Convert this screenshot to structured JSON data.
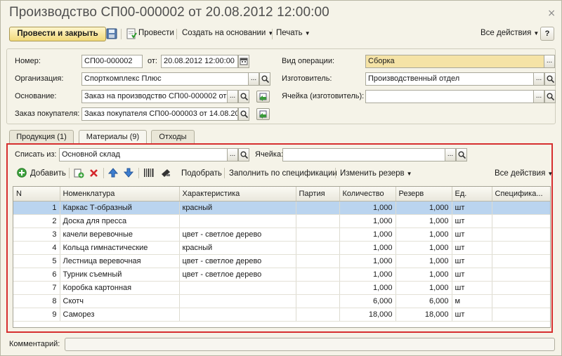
{
  "window": {
    "title": "Производство СП00-000002 от 20.08.2012 12:00:00",
    "close_glyph": "×"
  },
  "toolbar": {
    "post_close": "Провести и закрыть",
    "post": "Провести",
    "create_based": "Создать на основании",
    "print": "Печать",
    "all_actions": "Все действия",
    "help": "?"
  },
  "header": {
    "number_label": "Номер:",
    "number_value": "СП00-000002",
    "date_label": "от:",
    "date_value": "20.08.2012 12:00:00",
    "org_label": "Организация:",
    "org_value": "Спорткомплекс Плюс",
    "base_label": "Основание:",
    "base_value": "Заказ на производство СП00-000002 от",
    "order_label": "Заказ покупателя:",
    "order_value": "Заказ покупателя СП00-000003 от 14.08.20",
    "op_type_label": "Вид операции:",
    "op_type_value": "Сборка",
    "maker_label": "Изготовитель:",
    "maker_value": "Производственный отдел",
    "cell_label": "Ячейка (изготовитель):",
    "cell_value": ""
  },
  "tabs": [
    {
      "label": "Продукция (1)"
    },
    {
      "label": "Материалы (9)"
    },
    {
      "label": "Отходы"
    }
  ],
  "materials": {
    "writeoff_label": "Списать из:",
    "writeoff_value": "Основной склад",
    "cell_label": "Ячейка:",
    "cell_value": "",
    "add": "Добавить",
    "pick": "Подобрать",
    "fill_spec": "Заполнить по спецификации",
    "change_reserve": "Изменить резерв",
    "all_actions": "Все действия"
  },
  "grid": {
    "columns": [
      "N",
      "Номенклатура",
      "Характеристика",
      "Партия",
      "Количество",
      "Резерв",
      "Ед.",
      "Специфика..."
    ],
    "rows": [
      {
        "n": "1",
        "name": "Каркас Т-образный",
        "char": "красный",
        "batch": "",
        "qty": "1,000",
        "reserve": "1,000",
        "unit": "шт",
        "spec": ""
      },
      {
        "n": "2",
        "name": "Доска для пресса",
        "char": "",
        "batch": "",
        "qty": "1,000",
        "reserve": "1,000",
        "unit": "шт",
        "spec": ""
      },
      {
        "n": "3",
        "name": "качели веревочные",
        "char": "цвет - светлое дерево",
        "batch": "",
        "qty": "1,000",
        "reserve": "1,000",
        "unit": "шт",
        "spec": ""
      },
      {
        "n": "4",
        "name": "Кольца гимнастические",
        "char": "красный",
        "batch": "",
        "qty": "1,000",
        "reserve": "1,000",
        "unit": "шт",
        "spec": ""
      },
      {
        "n": "5",
        "name": "Лестница веревочная",
        "char": "цвет - светлое дерево",
        "batch": "",
        "qty": "1,000",
        "reserve": "1,000",
        "unit": "шт",
        "spec": ""
      },
      {
        "n": "6",
        "name": "Турник съемный",
        "char": "цвет - светлое дерево",
        "batch": "",
        "qty": "1,000",
        "reserve": "1,000",
        "unit": "шт",
        "spec": ""
      },
      {
        "n": "7",
        "name": "Коробка картонная",
        "char": "",
        "batch": "",
        "qty": "1,000",
        "reserve": "1,000",
        "unit": "шт",
        "spec": ""
      },
      {
        "n": "8",
        "name": "Скотч",
        "char": "",
        "batch": "",
        "qty": "6,000",
        "reserve": "6,000",
        "unit": "м",
        "spec": ""
      },
      {
        "n": "9",
        "name": "Саморез",
        "char": "",
        "batch": "",
        "qty": "18,000",
        "reserve": "18,000",
        "unit": "шт",
        "spec": ""
      }
    ]
  },
  "footer": {
    "comment_label": "Комментарий:",
    "comment_value": ""
  },
  "colors": {
    "highlight_frame": "#d62f2f",
    "selected_row": "#bad4ef",
    "primary_button": "#f1d97a",
    "required_field": "#f5e3a6"
  }
}
